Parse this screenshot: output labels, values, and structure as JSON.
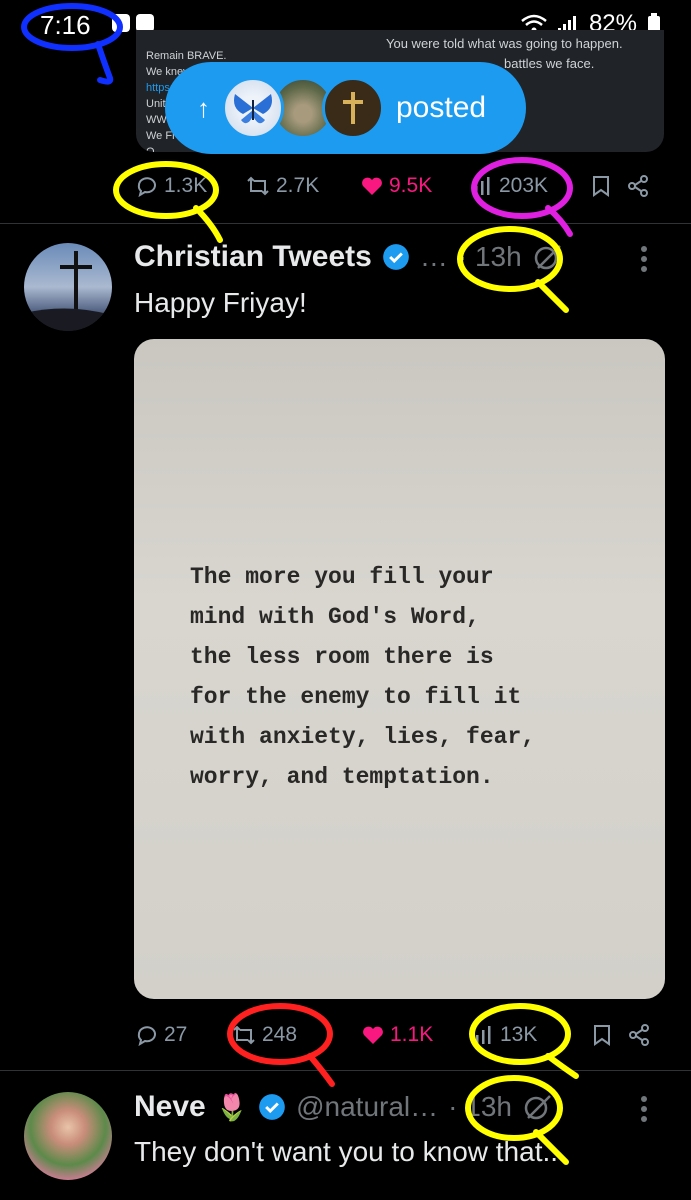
{
  "status_bar": {
    "time": "7:16",
    "battery": "82%"
  },
  "quoted_card": {
    "left_lines": [
      "Remain BRAVE.",
      "We knew",
      "https:",
      "Unit",
      "WWG",
      "We Fi",
      "Q"
    ],
    "right_lines": [
      "You were told what was going to happen.",
      "battles we face."
    ]
  },
  "posted_pill": {
    "arrow": "↑",
    "label": "posted"
  },
  "tweet0_actions": {
    "replies": "1.3K",
    "retweets": "2.7K",
    "likes": "9.5K",
    "views": "203K"
  },
  "tweet1": {
    "name": "Christian Tweets",
    "ellipsis": "…",
    "time": "· 13h",
    "text": "Happy Friyay!",
    "image_quote": "The more you fill your\nmind with God's Word,\nthe less room there is\nfor the enemy to fill it\nwith anxiety, lies, fear,\nworry, and temptation.",
    "actions": {
      "replies": "27",
      "retweets": "248",
      "likes": "1.1K",
      "views": "13K"
    }
  },
  "tweet2": {
    "name": "Neve",
    "emoji": "🌷",
    "handle": "@natural…",
    "time": "· 13h",
    "text": "They don't want you to know that..."
  },
  "colors": {
    "accent": "#1d9bf0",
    "like": "#f91880",
    "annotation_blue": "#1030ff",
    "annotation_yellow": "#ffff00",
    "annotation_magenta": "#e020e0",
    "annotation_red": "#ff2020"
  }
}
